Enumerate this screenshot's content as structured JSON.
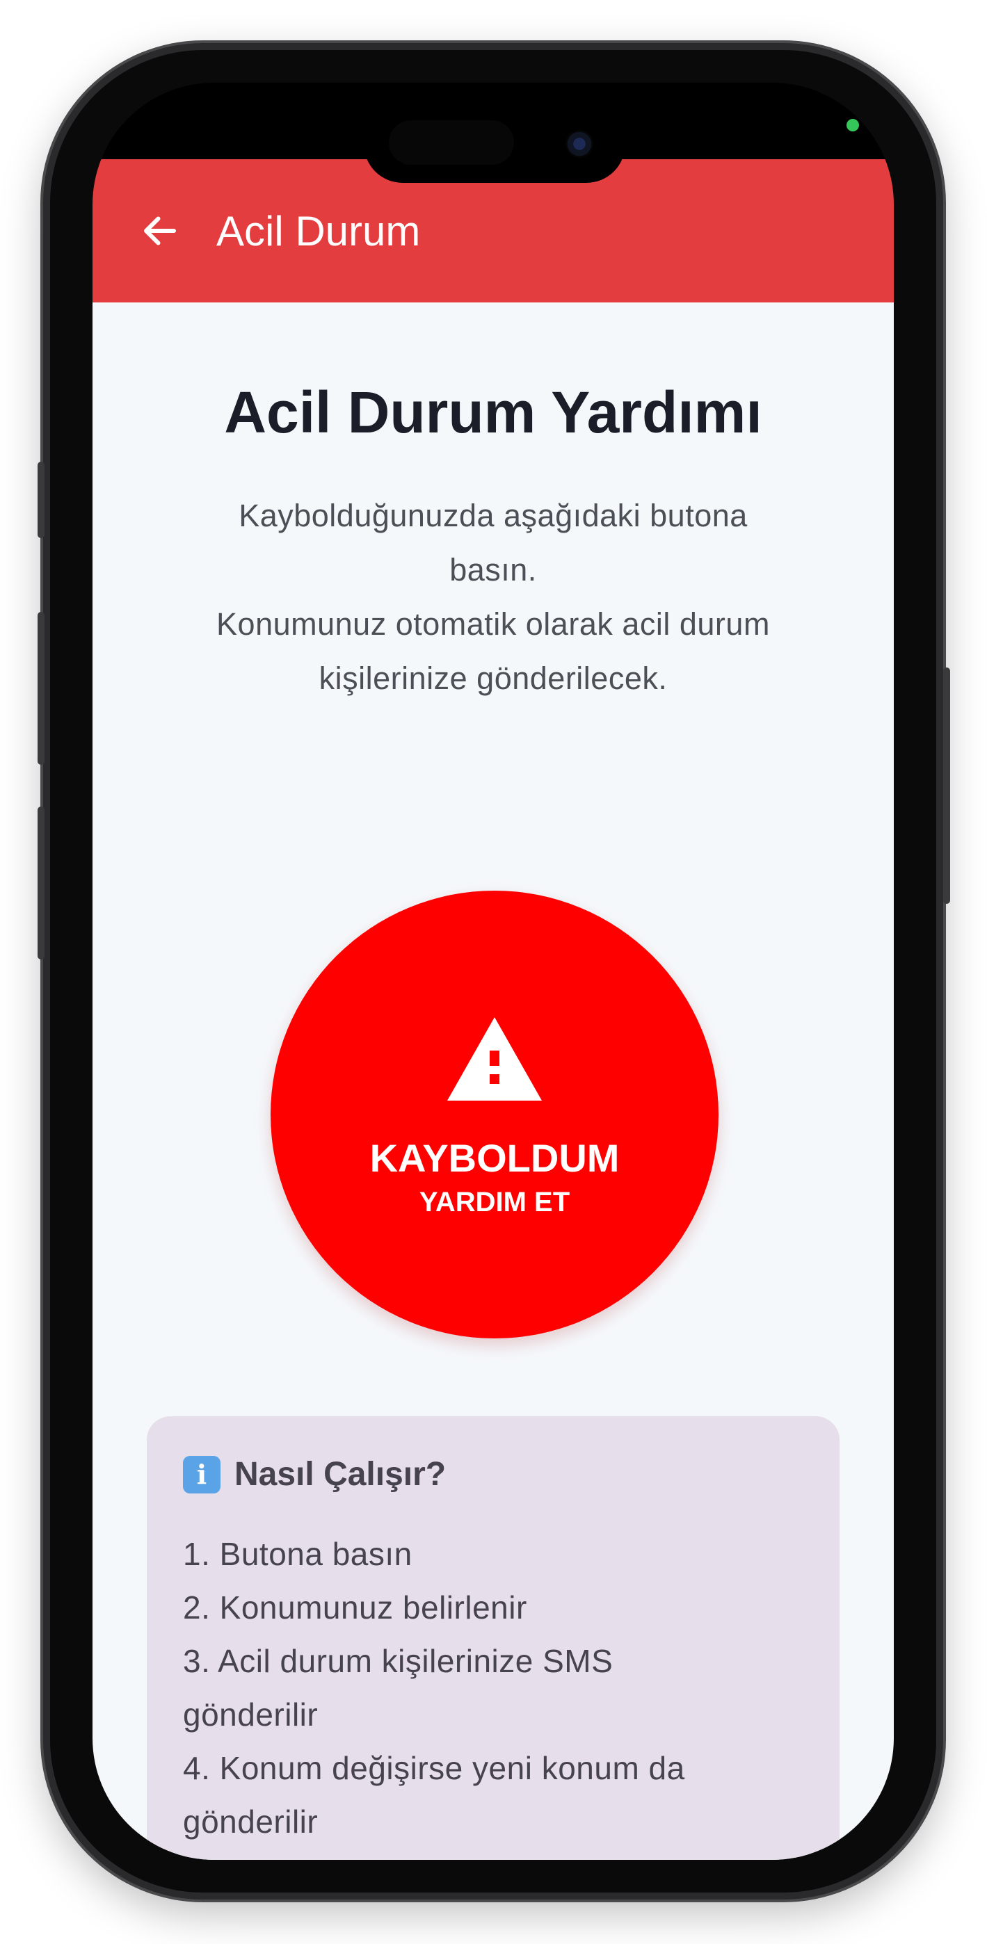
{
  "app_bar": {
    "title": "Acil Durum",
    "back_icon": "arrow-left-icon",
    "color": "#e43d40"
  },
  "main": {
    "heading": "Acil Durum Yardımı",
    "description": [
      "Kaybolduğunuzda aşağıdaki butona",
      "basın.",
      "Konumunuz otomatik olarak acil durum",
      "kişilerinize gönderilecek."
    ]
  },
  "sos_button": {
    "icon": "warning-icon",
    "label": "KAYBOLDUM",
    "sublabel": "YARDIM ET",
    "color": "#fe0000"
  },
  "info_card": {
    "icon": "info-icon",
    "icon_glyph": "i",
    "title": "Nasıl Çalışır?",
    "steps": [
      "1. Butona basın",
      "2. Konumunuz belirlenir",
      "3. Acil durum kişilerinize SMS",
      "gönderilir",
      "4. Konum değişirse yeni konum da",
      "gönderilir"
    ],
    "background": "#e6dfeb"
  }
}
